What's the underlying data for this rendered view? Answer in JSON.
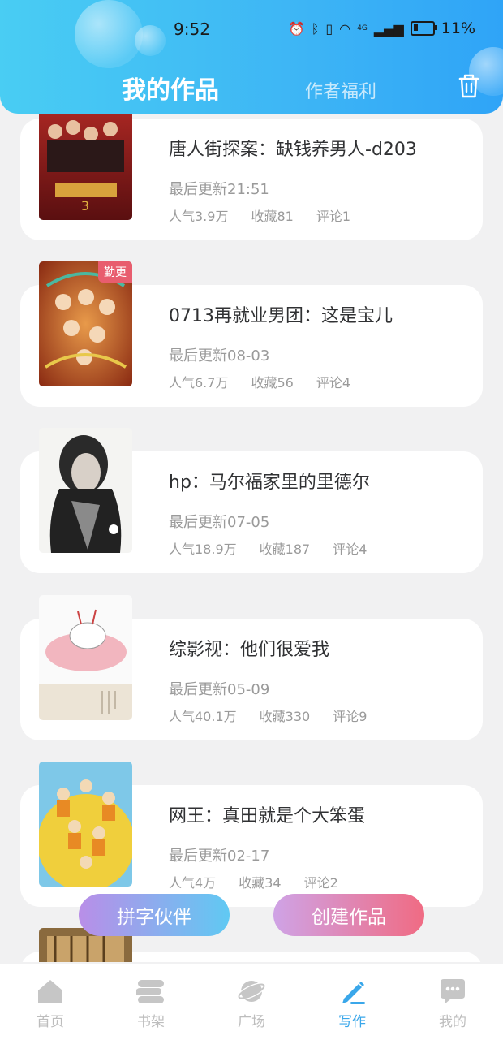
{
  "status_bar": {
    "time": "9:52",
    "battery": "11%",
    "network": "4G"
  },
  "header": {
    "tab_active": "我的作品",
    "tab_other": "作者福利",
    "trash_icon": "trash-icon"
  },
  "works": [
    {
      "title": "唐人街探案：缺钱养男人-d203",
      "updated": "最后更新21:51",
      "popularity": "人气3.9万",
      "favorites": "收藏81",
      "comments": "评论1",
      "badge": ""
    },
    {
      "title": "0713再就业男团：这是宝儿",
      "updated": "最后更新08-03",
      "popularity": "人气6.7万",
      "favorites": "收藏56",
      "comments": "评论4",
      "badge": "勤更"
    },
    {
      "title": "hp：马尔福家里的里德尔",
      "updated": "最后更新07-05",
      "popularity": "人气18.9万",
      "favorites": "收藏187",
      "comments": "评论4",
      "badge": ""
    },
    {
      "title": "综影视：他们很爱我",
      "updated": "最后更新05-09",
      "popularity": "人气40.1万",
      "favorites": "收藏330",
      "comments": "评论9",
      "badge": ""
    },
    {
      "title": "网王：真田就是个大笨蛋",
      "updated": "最后更新02-17",
      "popularity": "人气4万",
      "favorites": "收藏34",
      "comments": "评论2",
      "badge": ""
    }
  ],
  "buttons": {
    "partner": "拼字伙伴",
    "create": "创建作品"
  },
  "bottom_nav": [
    {
      "label": "首页",
      "icon": "home-icon"
    },
    {
      "label": "书架",
      "icon": "bookshelf-icon"
    },
    {
      "label": "广场",
      "icon": "planet-icon"
    },
    {
      "label": "写作",
      "icon": "pen-icon"
    },
    {
      "label": "我的",
      "icon": "chat-bubble-icon"
    }
  ],
  "colors": {
    "accent": "#3aa7ea",
    "header_start": "#49cdf3",
    "header_end": "#2fa4f7",
    "badge": "#e85d6e",
    "create_start": "#cfa3e6",
    "create_end": "#f06b83",
    "partner_start": "#b98ee8",
    "partner_end": "#60c9f3"
  }
}
